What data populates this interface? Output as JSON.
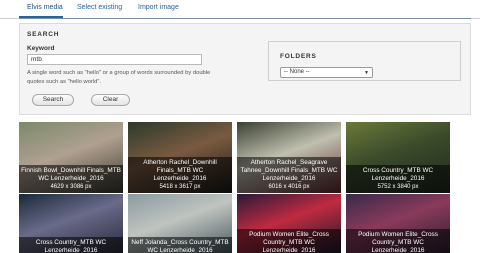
{
  "tabs": [
    {
      "label": "Elvis media",
      "active": true
    },
    {
      "label": "Select existing",
      "active": false
    },
    {
      "label": "Import image",
      "active": false
    }
  ],
  "search": {
    "title": "SEARCH",
    "keyword_label": "Keyword",
    "keyword_value": "mtb",
    "help_text": "A single word such as \"hello\" or a group of words surrounded by double quotes such as \"hello world\".",
    "search_button": "Search",
    "clear_button": "Clear"
  },
  "folders": {
    "title": "FOLDERS",
    "selected": "-- None --"
  },
  "thumbnails": [
    {
      "title": "Finnish Bowl_Downhill Finals_MTB WC Lenzerheide_2016",
      "dims": "4629 x 3086 px",
      "colors": [
        "#7a8a6a",
        "#b0a090",
        "#3a3a30"
      ]
    },
    {
      "title": "Atherton Rachel_Downhill Finals_MTB WC Lenzerheide_2016",
      "dims": "5418 x 3617 px",
      "colors": [
        "#2c3a2c",
        "#7a5a40",
        "#1a1a1a"
      ]
    },
    {
      "title": "Atherton Rachel_Seagrave Tahnee_Downhill Finals_MTB WC Lenzerheide_2016",
      "dims": "6016 x 4016 px",
      "colors": [
        "#3a4030",
        "#c0c0b0",
        "#5a2a2a"
      ]
    },
    {
      "title": "Cross Country_MTB WC Lenzerheide_2016",
      "dims": "5752 x 3840 px",
      "colors": [
        "#6a7a3a",
        "#3a4a2a",
        "#202820"
      ]
    },
    {
      "title": "Cross Country_MTB WC Lenzerheide_2016",
      "dims": "",
      "colors": [
        "#1a2a3a",
        "#6a6a8a",
        "#2a2a3a"
      ]
    },
    {
      "title": "Neff Jolanda_Cross Country_MTB WC Lenzerheide_2016",
      "dims": "",
      "colors": [
        "#8a9aa0",
        "#c0c4c0",
        "#4a5a60"
      ]
    },
    {
      "title": "Podium Women Elite_Cross Country_MTB WC Lenzerheide_2016",
      "dims": "",
      "colors": [
        "#2a1a3a",
        "#c02a40",
        "#1a1a2a"
      ]
    },
    {
      "title": "Podium Women Elite_Cross Country_MTB WC Lenzerheide_2016",
      "dims": "",
      "colors": [
        "#3a2a4a",
        "#8a3a5a",
        "#2a2030"
      ]
    }
  ]
}
